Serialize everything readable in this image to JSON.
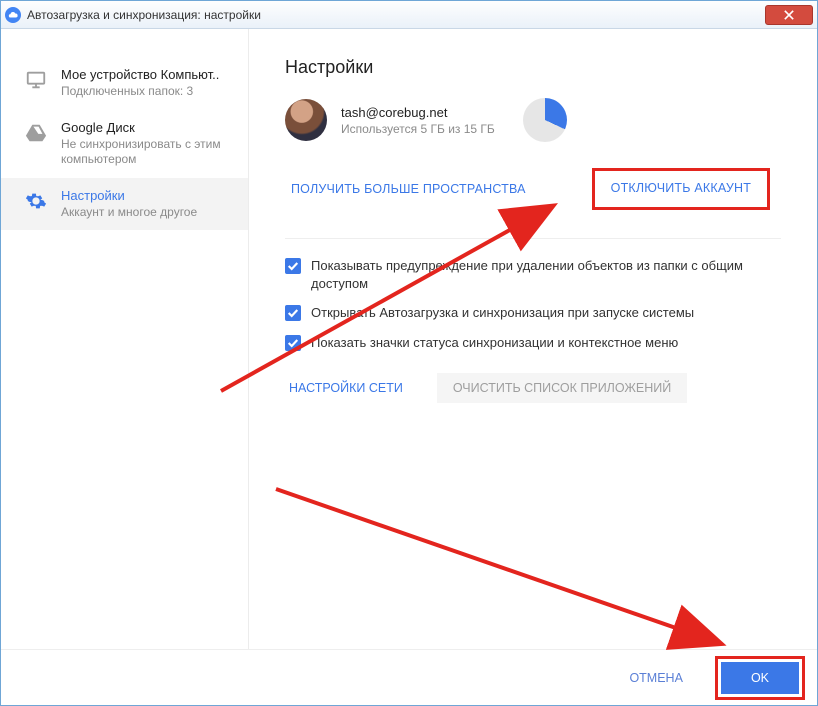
{
  "window": {
    "title": "Автозагрузка и синхронизация: настройки"
  },
  "sidebar": {
    "items": [
      {
        "title": "Мое устройство Компьют..",
        "sub": "Подключенных папок: 3"
      },
      {
        "title": "Google Диск",
        "sub": "Не синхронизировать с этим компьютером"
      },
      {
        "title": "Настройки",
        "sub": "Аккаунт и многое другое"
      }
    ]
  },
  "settings": {
    "heading": "Настройки",
    "account": {
      "email": "tash@corebug.net",
      "usage": "Используется 5 ГБ из 15 ГБ"
    },
    "get_more_space": "ПОЛУЧИТЬ БОЛЬШЕ ПРОСТРАНСТВА",
    "disconnect": "ОТКЛЮЧИТЬ АККАУНТ",
    "checks": [
      "Показывать предупреждение при удалении объектов из папки с общим доступом",
      "Открывать Автозагрузка и синхронизация при запуске системы",
      "Показать значки статуса синхронизации и контекстное меню"
    ],
    "network": "НАСТРОЙКИ СЕТИ",
    "clear_apps": "ОЧИСТИТЬ СПИСОК ПРИЛОЖЕНИЙ"
  },
  "footer": {
    "cancel": "ОТМЕНА",
    "ok": "OK"
  },
  "colors": {
    "accent": "#3b78e7",
    "annotation": "#e3251e"
  }
}
